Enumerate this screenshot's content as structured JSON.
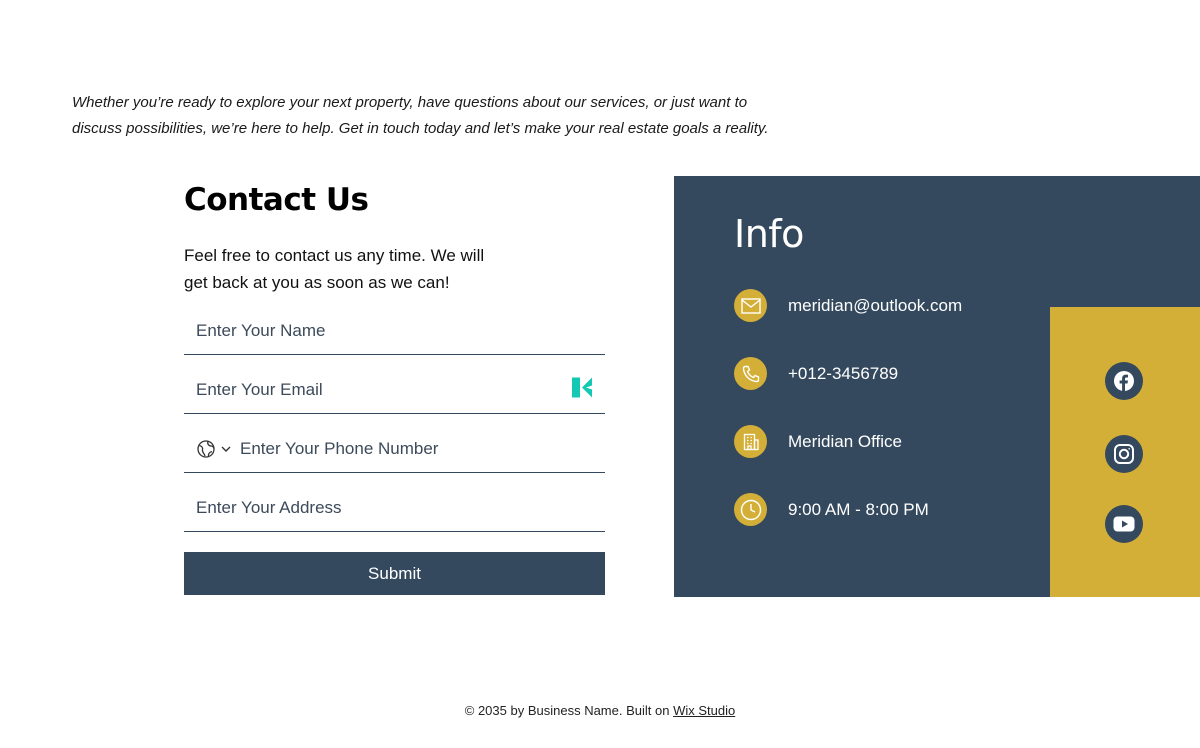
{
  "intro": {
    "text": "Whether you’re ready to explore your next property, have questions about our services, or just want to discuss possibilities, we’re here to help. Get in touch today and let’s make your real estate goals a reality."
  },
  "form": {
    "title": "Contact Us",
    "description": "Feel free to contact us any time. We will get back at you as soon as we can!",
    "name_placeholder": "Enter Your Name",
    "email_placeholder": "Enter Your Email",
    "phone_placeholder": "Enter Your Phone Number",
    "address_placeholder": "Enter Your Address",
    "submit_label": "Submit",
    "icons": {
      "globe": "globe-icon",
      "chevron": "chevron-down-icon",
      "autofill": "autofill-extension-icon"
    }
  },
  "info": {
    "title": "Info",
    "items": [
      {
        "icon": "mail-icon",
        "text": "meridian@outlook.com"
      },
      {
        "icon": "phone-icon",
        "text": "+012-3456789"
      },
      {
        "icon": "building-icon",
        "text": "Meridian Office"
      },
      {
        "icon": "clock-icon",
        "text": "9:00 AM - 8:00 PM"
      }
    ],
    "social": [
      "facebook-icon",
      "instagram-icon",
      "youtube-icon"
    ]
  },
  "footer": {
    "text": "© 2035 by Business Name. Built on ",
    "link": "Wix Studio"
  },
  "colors": {
    "navy": "#34495e",
    "gold": "#d4af37",
    "white": "#ffffff",
    "teal": "#14c8b4"
  }
}
